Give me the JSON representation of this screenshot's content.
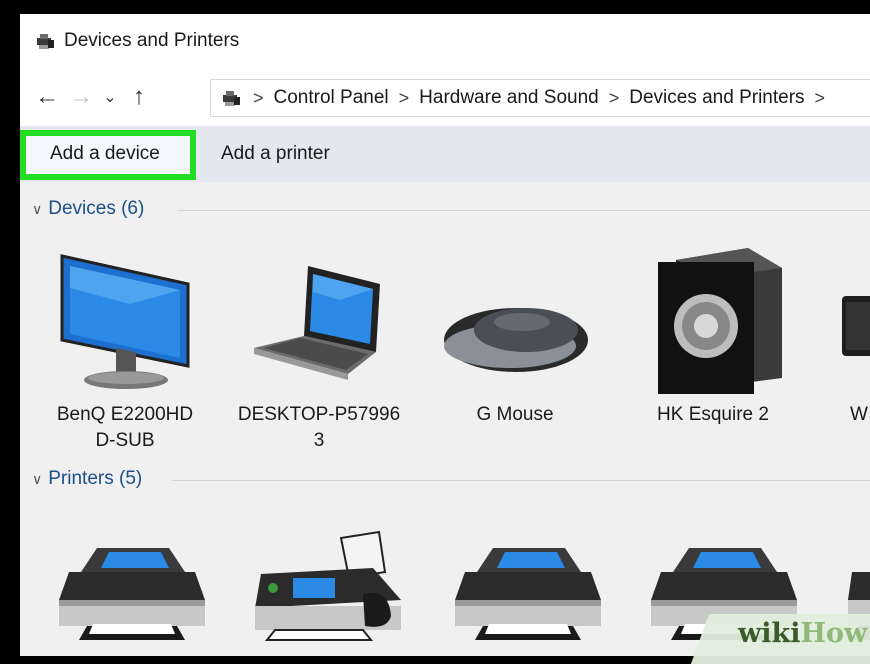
{
  "window": {
    "title": "Devices and Printers",
    "title_icon": "devices-printers-icon"
  },
  "navigation": {
    "back_icon": "back-arrow-icon",
    "forward_icon": "forward-arrow-icon",
    "recent_icon": "chevron-down-icon",
    "up_icon": "up-arrow-icon",
    "breadcrumb": [
      "Control Panel",
      "Hardware and Sound",
      "Devices and Printers"
    ],
    "separator": ">"
  },
  "toolbar": {
    "add_device": "Add a device",
    "add_printer": "Add a printer",
    "highlight_color": "#22dd22"
  },
  "groups": {
    "devices": {
      "header": "Devices (6)",
      "items": [
        {
          "label_line1": "BenQ E2200HD",
          "label_line2": "D-SUB",
          "icon": "monitor-icon"
        },
        {
          "label_line1": "DESKTOP-P57996",
          "label_line2": "3",
          "icon": "laptop-icon"
        },
        {
          "label_line1": "G Mouse",
          "label_line2": "",
          "icon": "mouse-icon"
        },
        {
          "label_line1": "HK Esquire 2",
          "label_line2": "",
          "icon": "speaker-icon"
        },
        {
          "label_line1": "W",
          "label_line2": "",
          "icon": "keyboard-icon"
        }
      ]
    },
    "printers": {
      "header": "Printers (5)",
      "items": [
        {
          "icon": "printer-icon"
        },
        {
          "icon": "fax-icon"
        },
        {
          "icon": "printer-icon"
        },
        {
          "icon": "printer-icon"
        },
        {
          "icon": "printer-icon"
        }
      ]
    }
  },
  "watermark": {
    "part1": "wiki",
    "part2": "How"
  }
}
